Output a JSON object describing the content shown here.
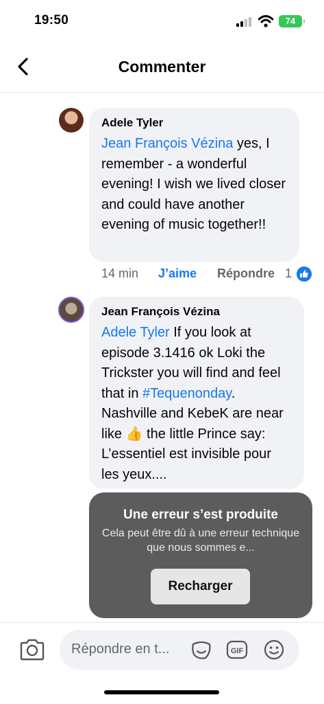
{
  "status_bar": {
    "time": "19:50",
    "battery": "74"
  },
  "header": {
    "title": "Commenter"
  },
  "comments": [
    {
      "author": "Adele Tyler",
      "mention": "Jean François Vézina",
      "text": " yes, I remember - a wonderful evening!   I wish we lived closer and could have another evening of music together!!",
      "time_ago": "14 min",
      "like_label": "J’aime",
      "reply_label": "Répondre",
      "like_count": "1"
    },
    {
      "author": "Jean François Vézina",
      "mention": "Adele Tyler",
      "text_1": " If you look at episode 3.1416 ok Loki the Trickster you will find and feel that in ",
      "hashtag": "#Tequenonday",
      "text_2": ". Nashville and KebeK are near like ",
      "emoji": "👍",
      "text_3": " the little Prince say: L’essentiel est invisible pour les yeux...."
    }
  ],
  "error_toast": {
    "title": "Une erreur s’est produite",
    "message": "Cela peut être dû à une erreur technique que nous sommes e...",
    "reload_label": "Recharger"
  },
  "composer": {
    "placeholder": "Répondre en t..."
  },
  "colors": {
    "accent": "#1877f2",
    "bubble": "#f0f2f5",
    "toast": "#5c5c5c",
    "battery": "#35c759"
  }
}
